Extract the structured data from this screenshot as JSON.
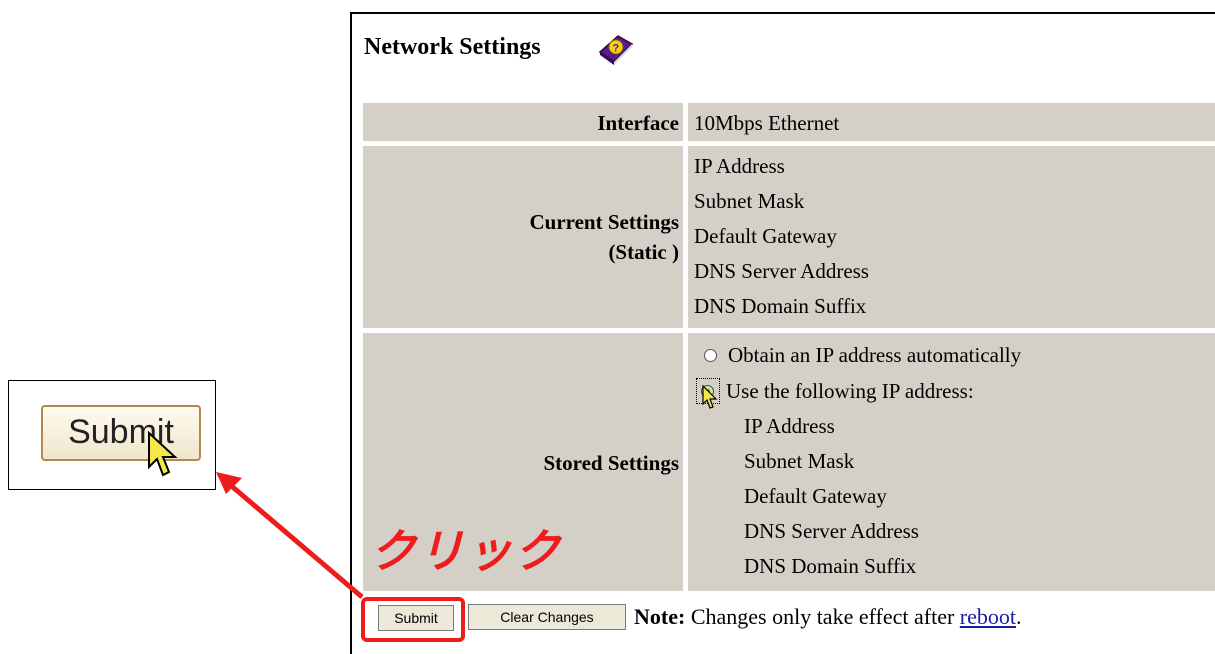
{
  "title": "Network Settings",
  "interface": {
    "label": "Interface",
    "value": "10Mbps Ethernet"
  },
  "current": {
    "label_line1": "Current Settings",
    "label_line2": "(Static )",
    "fields": [
      "IP Address",
      "Subnet Mask",
      "Default Gateway",
      "DNS Server Address",
      "DNS Domain Suffix"
    ]
  },
  "stored": {
    "label": "Stored Settings",
    "radio_auto": "Obtain an IP address automatically",
    "radio_static": "Use the following IP address:",
    "selected": "static",
    "fields": [
      "IP Address",
      "Subnet Mask",
      "Default Gateway",
      "DNS Server Address",
      "DNS Domain Suffix"
    ]
  },
  "buttons": {
    "submit": "Submit",
    "clear": "Clear Changes"
  },
  "note": {
    "prefix": "Note:",
    "text": " Changes only take effect after ",
    "link": "reboot",
    "suffix": "."
  },
  "callout": {
    "button_label": "Submit"
  },
  "annotation": {
    "text": "クリック",
    "color": "#ee1c1c"
  },
  "icons": {
    "help": "help-book-icon",
    "cursor": "mouse-pointer-icon"
  }
}
